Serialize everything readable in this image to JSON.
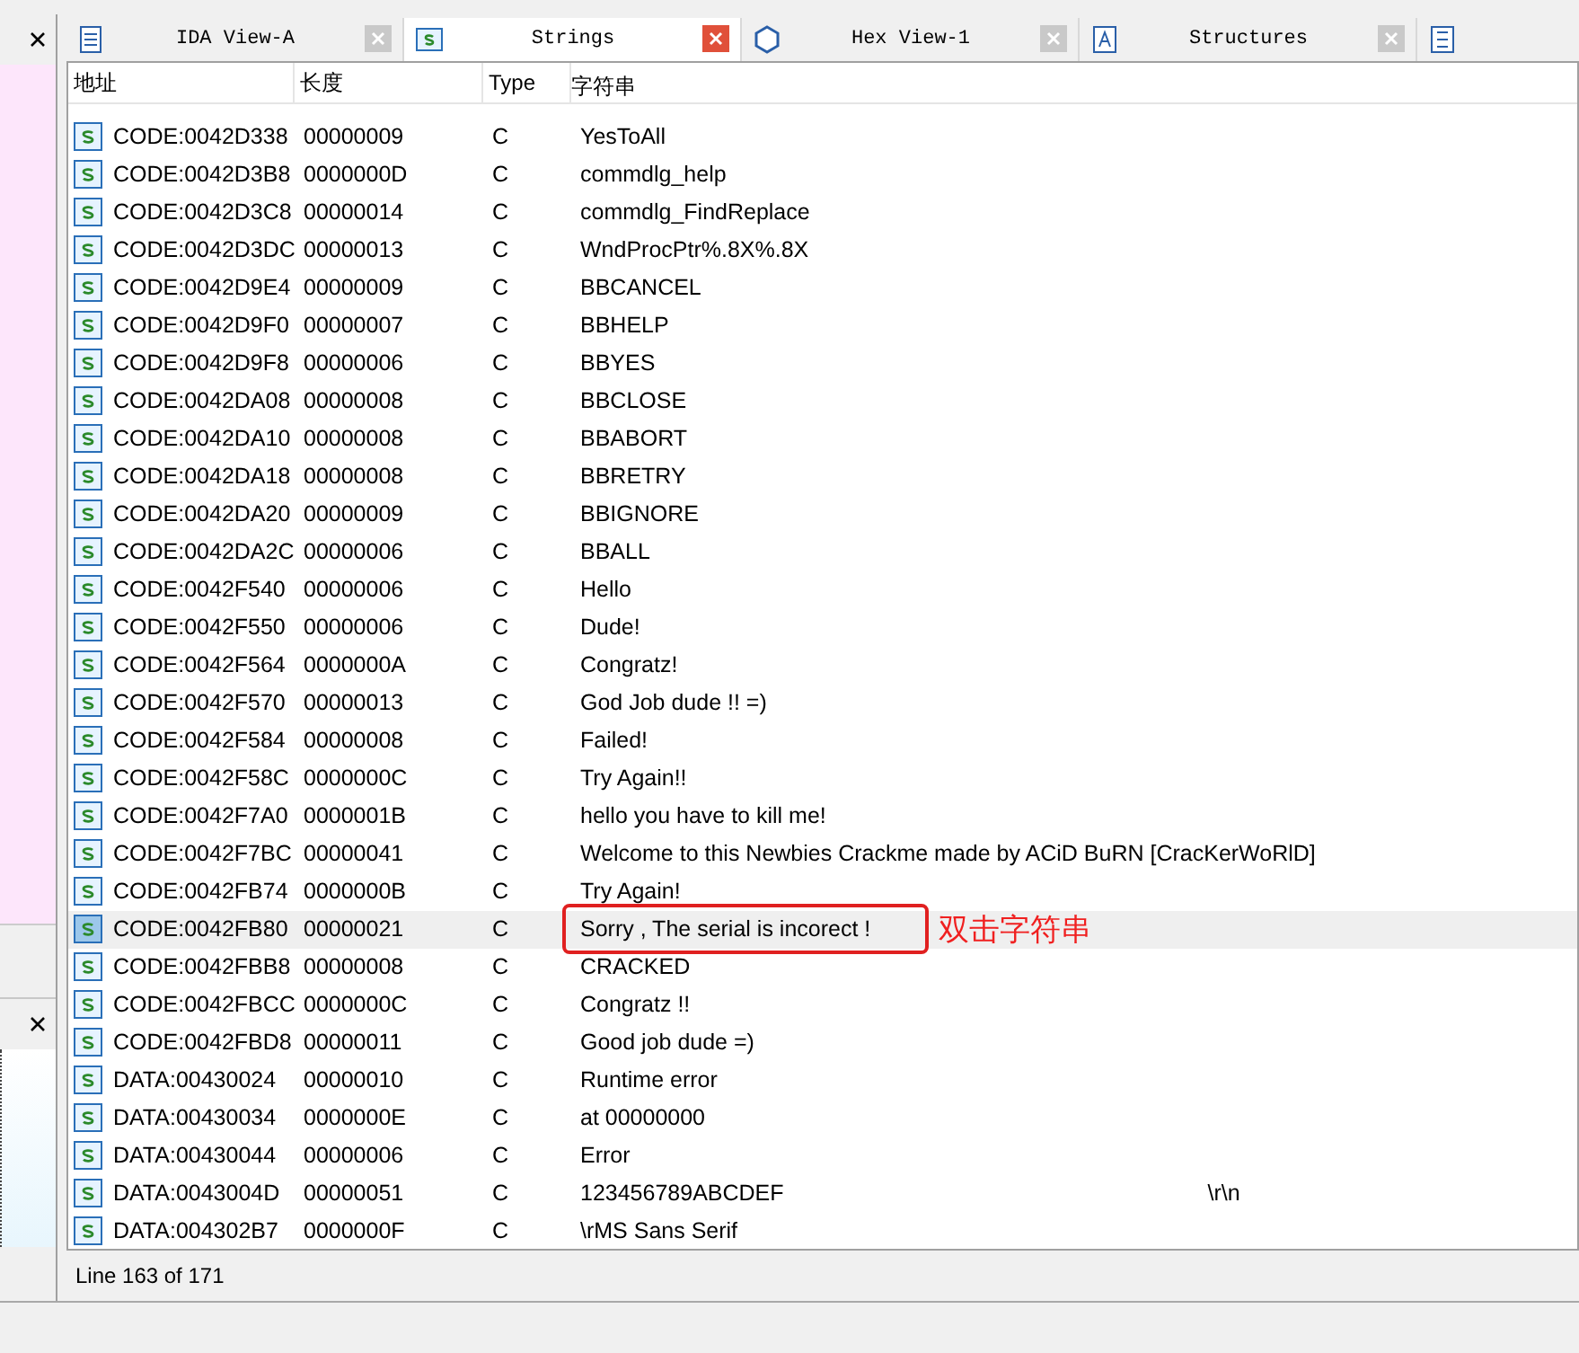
{
  "tabs": [
    {
      "label": "IDA View-A",
      "selected": false,
      "kind": "ida"
    },
    {
      "label": "Strings",
      "selected": true,
      "kind": "strings"
    },
    {
      "label": "Hex View-1",
      "selected": false,
      "kind": "hex"
    },
    {
      "label": "Structures",
      "selected": false,
      "kind": "struct"
    }
  ],
  "table": {
    "columns": [
      "地址",
      "长度",
      "Type",
      "字符串"
    ],
    "rows": [
      {
        "address": "CODE:0042D338",
        "length": "00000009",
        "type": "C",
        "string": "YesToAll",
        "selected": false
      },
      {
        "address": "CODE:0042D3B8",
        "length": "0000000D",
        "type": "C",
        "string": "commdlg_help",
        "selected": false
      },
      {
        "address": "CODE:0042D3C8",
        "length": "00000014",
        "type": "C",
        "string": "commdlg_FindReplace",
        "selected": false
      },
      {
        "address": "CODE:0042D3DC",
        "length": "00000013",
        "type": "C",
        "string": "WndProcPtr%.8X%.8X",
        "selected": false
      },
      {
        "address": "CODE:0042D9E4",
        "length": "00000009",
        "type": "C",
        "string": "BBCANCEL",
        "selected": false
      },
      {
        "address": "CODE:0042D9F0",
        "length": "00000007",
        "type": "C",
        "string": "BBHELP",
        "selected": false
      },
      {
        "address": "CODE:0042D9F8",
        "length": "00000006",
        "type": "C",
        "string": "BBYES",
        "selected": false
      },
      {
        "address": "CODE:0042DA08",
        "length": "00000008",
        "type": "C",
        "string": "BBCLOSE",
        "selected": false
      },
      {
        "address": "CODE:0042DA10",
        "length": "00000008",
        "type": "C",
        "string": "BBABORT",
        "selected": false
      },
      {
        "address": "CODE:0042DA18",
        "length": "00000008",
        "type": "C",
        "string": "BBRETRY",
        "selected": false
      },
      {
        "address": "CODE:0042DA20",
        "length": "00000009",
        "type": "C",
        "string": "BBIGNORE",
        "selected": false
      },
      {
        "address": "CODE:0042DA2C",
        "length": "00000006",
        "type": "C",
        "string": "BBALL",
        "selected": false
      },
      {
        "address": "CODE:0042F540",
        "length": "00000006",
        "type": "C",
        "string": "Hello",
        "selected": false
      },
      {
        "address": "CODE:0042F550",
        "length": "00000006",
        "type": "C",
        "string": "Dude!",
        "selected": false
      },
      {
        "address": "CODE:0042F564",
        "length": "0000000A",
        "type": "C",
        "string": "Congratz!",
        "selected": false
      },
      {
        "address": "CODE:0042F570",
        "length": "00000013",
        "type": "C",
        "string": "God Job dude !! =)",
        "selected": false
      },
      {
        "address": "CODE:0042F584",
        "length": "00000008",
        "type": "C",
        "string": "Failed!",
        "selected": false
      },
      {
        "address": "CODE:0042F58C",
        "length": "0000000C",
        "type": "C",
        "string": "Try Again!!",
        "selected": false
      },
      {
        "address": "CODE:0042F7A0",
        "length": "0000001B",
        "type": "C",
        "string": "hello you have to kill me!",
        "selected": false
      },
      {
        "address": "CODE:0042F7BC",
        "length": "00000041",
        "type": "C",
        "string": "Welcome to this Newbies Crackme made by ACiD BuRN [CracKerWoRlD]",
        "selected": false
      },
      {
        "address": "CODE:0042FB74",
        "length": "0000000B",
        "type": "C",
        "string": "Try Again!",
        "selected": false
      },
      {
        "address": "CODE:0042FB80",
        "length": "00000021",
        "type": "C",
        "string": "Sorry , The serial is incorect !",
        "selected": true,
        "note": "双击字符串"
      },
      {
        "address": "CODE:0042FBB8",
        "length": "00000008",
        "type": "C",
        "string": "CRACKED",
        "selected": false
      },
      {
        "address": "CODE:0042FBCC",
        "length": "0000000C",
        "type": "C",
        "string": "Congratz !!",
        "selected": false
      },
      {
        "address": "CODE:0042FBD8",
        "length": "00000011",
        "type": "C",
        "string": "Good job dude =)",
        "selected": false
      },
      {
        "address": "DATA:00430024",
        "length": "00000010",
        "type": "C",
        "string": "Runtime error",
        "selected": false
      },
      {
        "address": "DATA:00430034",
        "length": "0000000E",
        "type": "C",
        "string": "  at 00000000",
        "selected": false
      },
      {
        "address": "DATA:00430044",
        "length": "00000006",
        "type": "C",
        "string": "Error",
        "selected": false
      },
      {
        "address": "DATA:0043004D",
        "length": "00000051",
        "type": "C",
        "string": "123456789ABCDEF",
        "extra": "\\r\\n",
        "selected": false
      },
      {
        "address": "DATA:004302B7",
        "length": "0000000F",
        "type": "C",
        "string": "\\rMS Sans Serif",
        "selected": false
      }
    ]
  },
  "status_bar": "Line 163 of 171"
}
